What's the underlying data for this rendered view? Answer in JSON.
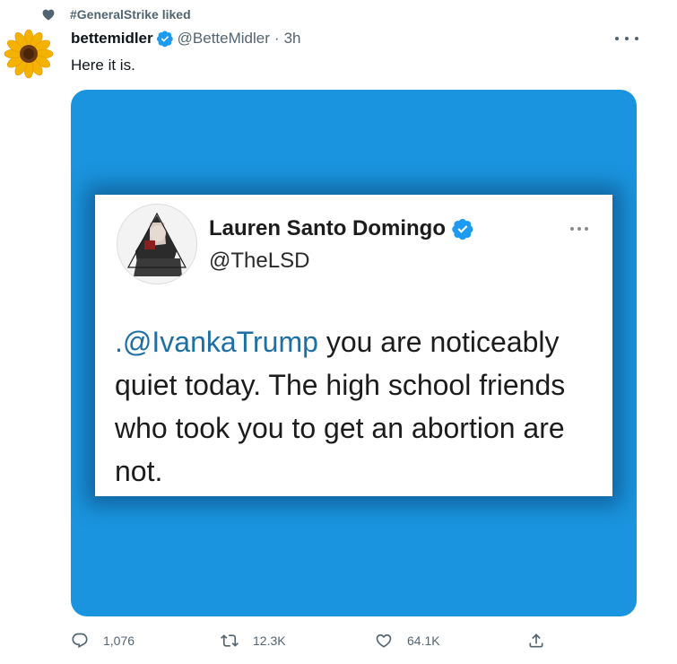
{
  "social_context": {
    "text": "#GeneralStrike liked",
    "icon": "heart-icon"
  },
  "tweet": {
    "author_name": "bettemidler",
    "author_handle": "@BetteMidler",
    "separator": "·",
    "timestamp": "3h",
    "text": "Here it is.",
    "verified": true
  },
  "media_card": {
    "author_name": "Lauren Santo Domingo",
    "author_handle": "@TheLSD",
    "mention": ".@IvankaTrump",
    "body_rest": " you are noticeably quiet today. The high school friends who took you to get an abortion are not."
  },
  "actions": {
    "replies": "1,076",
    "retweets": "12.3K",
    "likes": "64.1K"
  },
  "colors": {
    "accent": "#1d9bf0",
    "media_background": "#1a94de",
    "muted_text": "#536471"
  }
}
